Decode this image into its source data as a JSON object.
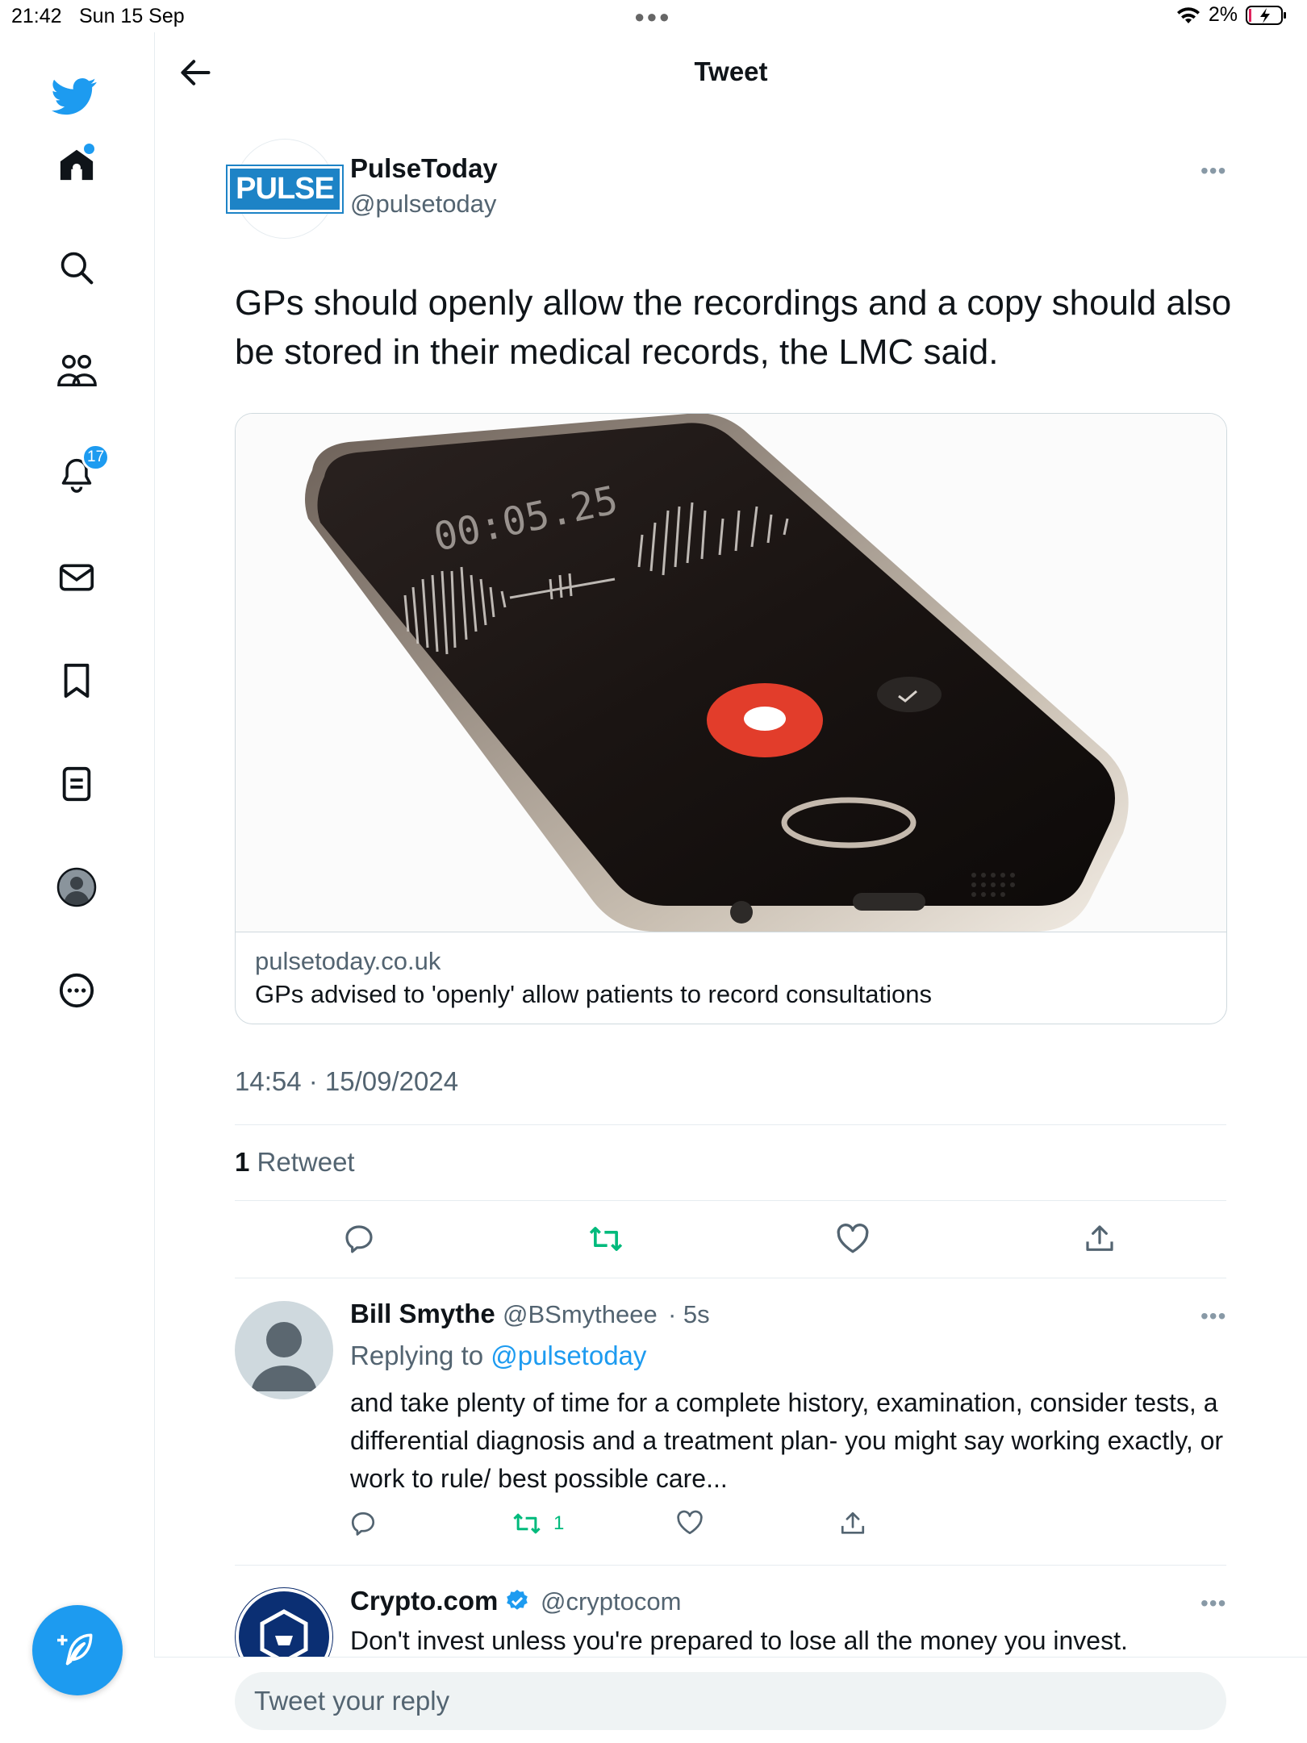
{
  "status_bar": {
    "time": "21:42",
    "date": "Sun 15 Sep",
    "battery": "2%"
  },
  "sidebar": {
    "items": [
      {
        "icon": "twitter-bird-icon"
      },
      {
        "icon": "home-icon",
        "has_dot": true
      },
      {
        "icon": "search-icon"
      },
      {
        "icon": "communities-icon"
      },
      {
        "icon": "bell-icon",
        "badge": "17"
      },
      {
        "icon": "mail-icon"
      },
      {
        "icon": "bookmark-icon"
      },
      {
        "icon": "lists-icon"
      },
      {
        "icon": "profile-avatar-icon"
      },
      {
        "icon": "more-circle-icon"
      }
    ],
    "compose_icon": "compose-feather-icon"
  },
  "header": {
    "title": "Tweet"
  },
  "tweet": {
    "author_name": "PulseToday",
    "author_handle": "@pulsetoday",
    "avatar_logo_text": "PULSE",
    "text": "GPs should openly allow the recordings and a copy should also be stored in their medical records, the LMC said.",
    "card": {
      "domain": "pulsetoday.co.uk",
      "title": "GPs advised to 'openly' allow patients to record consultations",
      "image_timer_text": "00:05.25"
    },
    "timestamp": "14:54 · 15/09/2024",
    "retweet_count": "1",
    "retweet_label": "Retweet"
  },
  "replies": [
    {
      "name": "Bill Smythe",
      "handle": "@BSmytheee",
      "time": "· 5s",
      "replying_prefix": "Replying to",
      "replying_to": "@pulsetoday",
      "text": "and take plenty of time for a complete history, examination, consider tests, a differential diagnosis and a treatment plan- you might say working exactly, or work to rule/ best possible care...",
      "retweet_count": "1"
    },
    {
      "name": "Crypto.com",
      "handle": "@cryptocom",
      "verified": true,
      "text": "Don't invest unless you're prepared to lose all the money you invest."
    }
  ],
  "reply_bar": {
    "placeholder": "Tweet your reply"
  },
  "colors": {
    "accent": "#1d9bf0",
    "retweet_green": "#00ba7c",
    "muted": "#536471",
    "border": "#e6ecf0"
  }
}
